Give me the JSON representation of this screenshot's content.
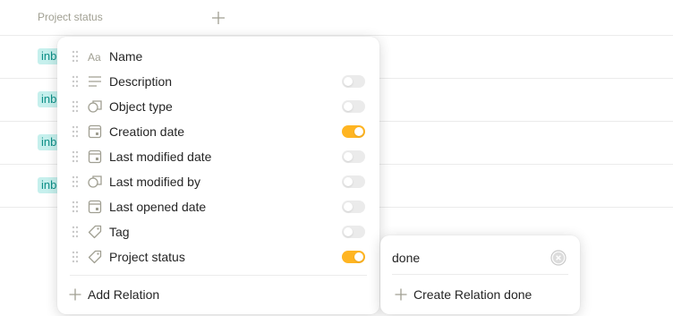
{
  "table": {
    "column_header": "Project status",
    "rows": [
      {
        "tag": "inbox"
      },
      {
        "tag": "inbox"
      },
      {
        "tag": "inbox"
      },
      {
        "tag": "inbox"
      }
    ]
  },
  "relations_menu": {
    "items": [
      {
        "label": "Name",
        "icon": "text-aa-icon",
        "toggle": null
      },
      {
        "label": "Description",
        "icon": "text-lines-icon",
        "toggle": false
      },
      {
        "label": "Object type",
        "icon": "object-shapes-icon",
        "toggle": false
      },
      {
        "label": "Creation date",
        "icon": "calendar-icon",
        "toggle": true
      },
      {
        "label": "Last modified date",
        "icon": "calendar-icon",
        "toggle": false
      },
      {
        "label": "Last modified by",
        "icon": "object-shapes-icon",
        "toggle": false
      },
      {
        "label": "Last opened date",
        "icon": "calendar-icon",
        "toggle": false
      },
      {
        "label": "Tag",
        "icon": "tag-icon",
        "toggle": false
      },
      {
        "label": "Project status",
        "icon": "tag-icon",
        "toggle": true
      }
    ],
    "add_relation_label": "Add Relation"
  },
  "search_popup": {
    "value": "done",
    "create_label": "Create Relation done"
  },
  "colors": {
    "toggle_on": "#ffb522",
    "toggle_off": "#ebebeb",
    "tag_bg": "#c6f0ed",
    "tag_text": "#0d8f87"
  }
}
